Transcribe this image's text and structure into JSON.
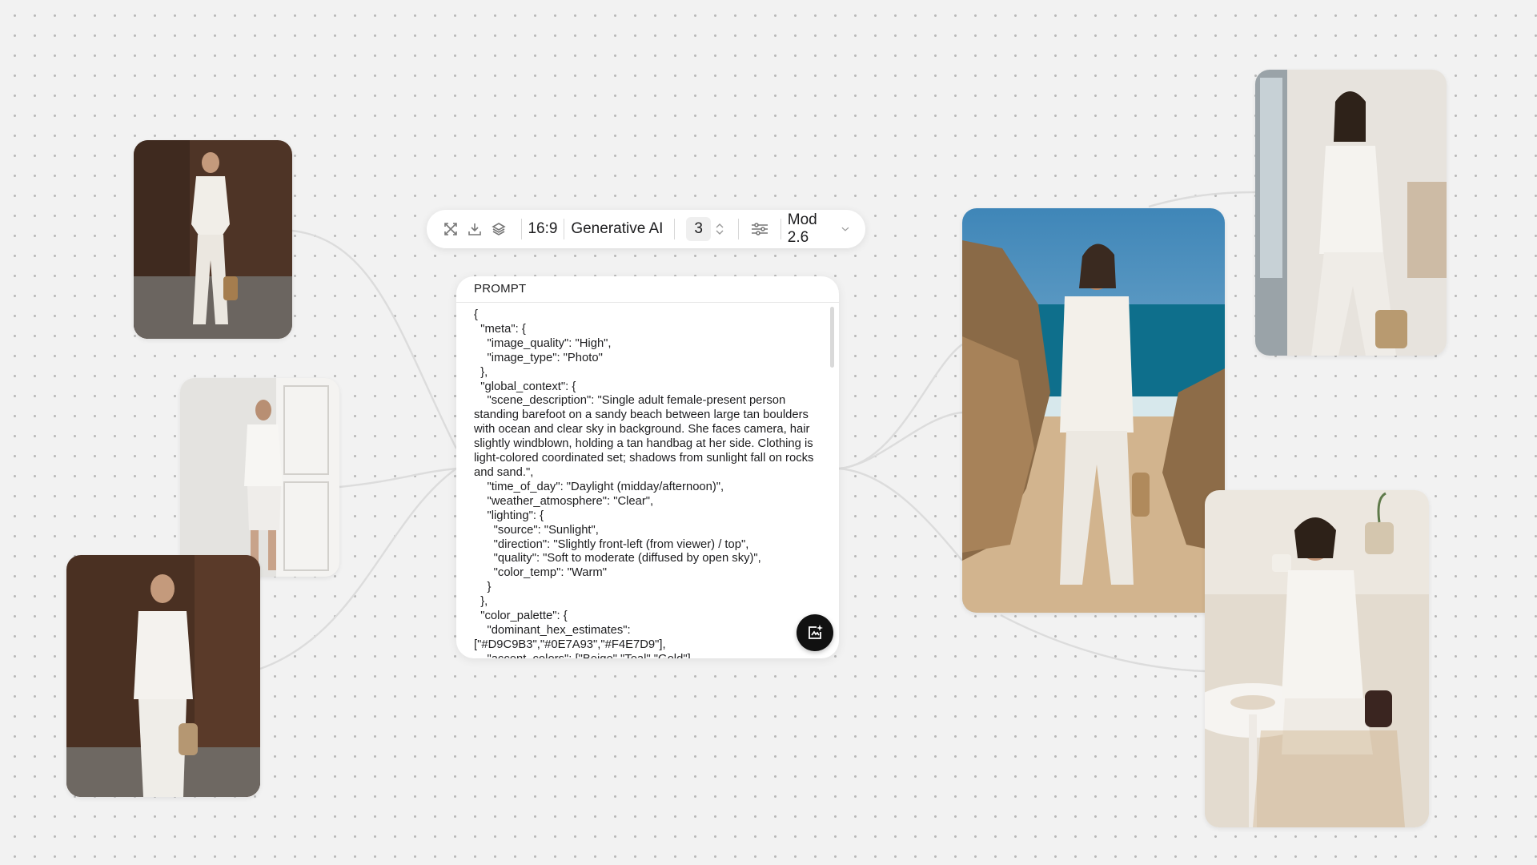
{
  "toolbar": {
    "aspect_ratio": "16:9",
    "mode": "Generative AI",
    "count": "3",
    "model": "Mod 2.6",
    "icons": [
      "expand-icon",
      "download-icon",
      "layers-icon",
      "sliders-icon",
      "chevron-down-icon"
    ]
  },
  "prompt": {
    "label": "PROMPT",
    "text": "{\n  \"meta\": {\n    \"image_quality\": \"High\",\n    \"image_type\": \"Photo\"\n  },\n  \"global_context\": {\n    \"scene_description\": \"Single adult female-present person standing barefoot on a sandy beach between large tan boulders with ocean and clear sky in background. She faces camera, hair slightly windblown, holding a tan handbag at her side. Clothing is light-colored coordinated set; shadows from sunlight fall on rocks and sand.\",\n    \"time_of_day\": \"Daylight (midday/afternoon)\",\n    \"weather_atmosphere\": \"Clear\",\n    \"lighting\": {\n      \"source\": \"Sunlight\",\n      \"direction\": \"Slightly front-left (from viewer) / top\",\n      \"quality\": \"Soft to moderate (diffused by open sky)\",\n      \"color_temp\": \"Warm\"\n    }\n  },\n  \"color_palette\": {\n    \"dominant_hex_estimates\": [\"#D9C9B3\",\"#0E7A93\",\"#F4E7D9\"],\n    \"accent_colors\": [\"Beige\",\"Teal\",\"Gold\"]"
  },
  "colors": {
    "canvas": "#f2f2f2",
    "connector": "#dcdcdc",
    "fab": "#111111"
  }
}
